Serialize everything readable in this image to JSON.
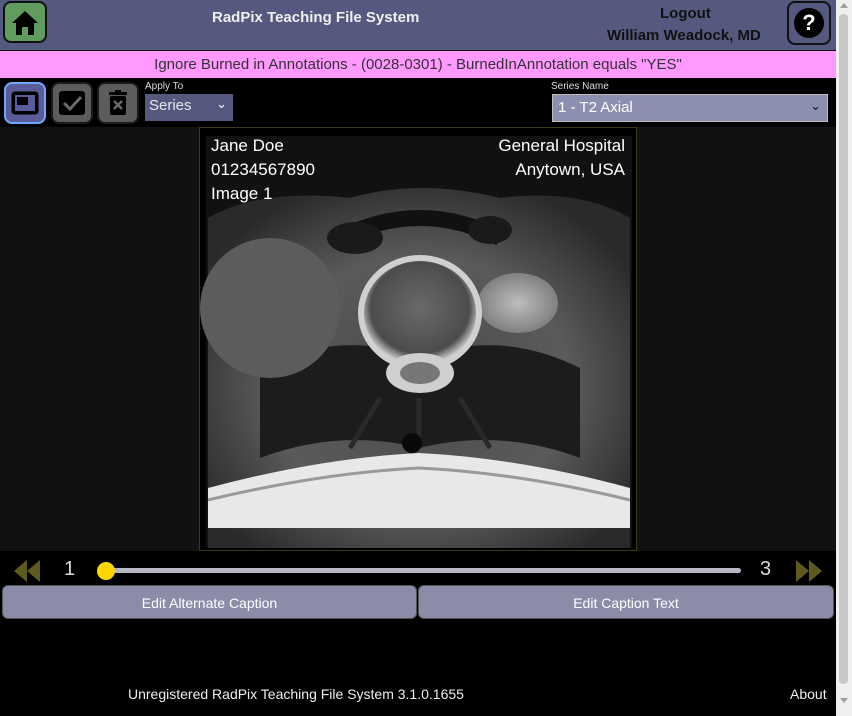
{
  "header": {
    "title": "RadPix Teaching File System",
    "logout_label": "Logout",
    "user_name": "William Weadock, MD",
    "home_icon": "home-icon",
    "help_icon": "help-icon"
  },
  "banner": {
    "text": "Ignore Burned in Annotations - (0028-0301) - BurnedInAnnotation equals \"YES\"",
    "color": "#ff99ff"
  },
  "toolbar": {
    "tools": [
      {
        "icon": "frame-icon",
        "active": true
      },
      {
        "icon": "check-icon",
        "active": false
      },
      {
        "icon": "delete-icon",
        "active": false
      }
    ],
    "apply_to": {
      "label": "Apply To",
      "value": "Series"
    },
    "series_name": {
      "label": "Series Name",
      "value": "1 - T2 Axial"
    }
  },
  "image": {
    "overlay_left": [
      "Jane Doe",
      "01234567890",
      "Image 1"
    ],
    "overlay_right": [
      "General Hospital",
      "Anytown, USA"
    ],
    "description": "Axial T2-weighted MRI slice of the spine"
  },
  "slider": {
    "min": "1",
    "max": "3",
    "current": 1,
    "thumb_color": "#ffd600"
  },
  "captions": {
    "alternate_label": "Edit Alternate Caption",
    "text_label": "Edit Caption Text"
  },
  "footer": {
    "version_text": "Unregistered RadPix Teaching File System 3.1.0.1655",
    "about_label": "About"
  },
  "colors": {
    "header_bg": "#55597f",
    "home_bg": "#5f9c5e",
    "accent": "#ffd600"
  }
}
